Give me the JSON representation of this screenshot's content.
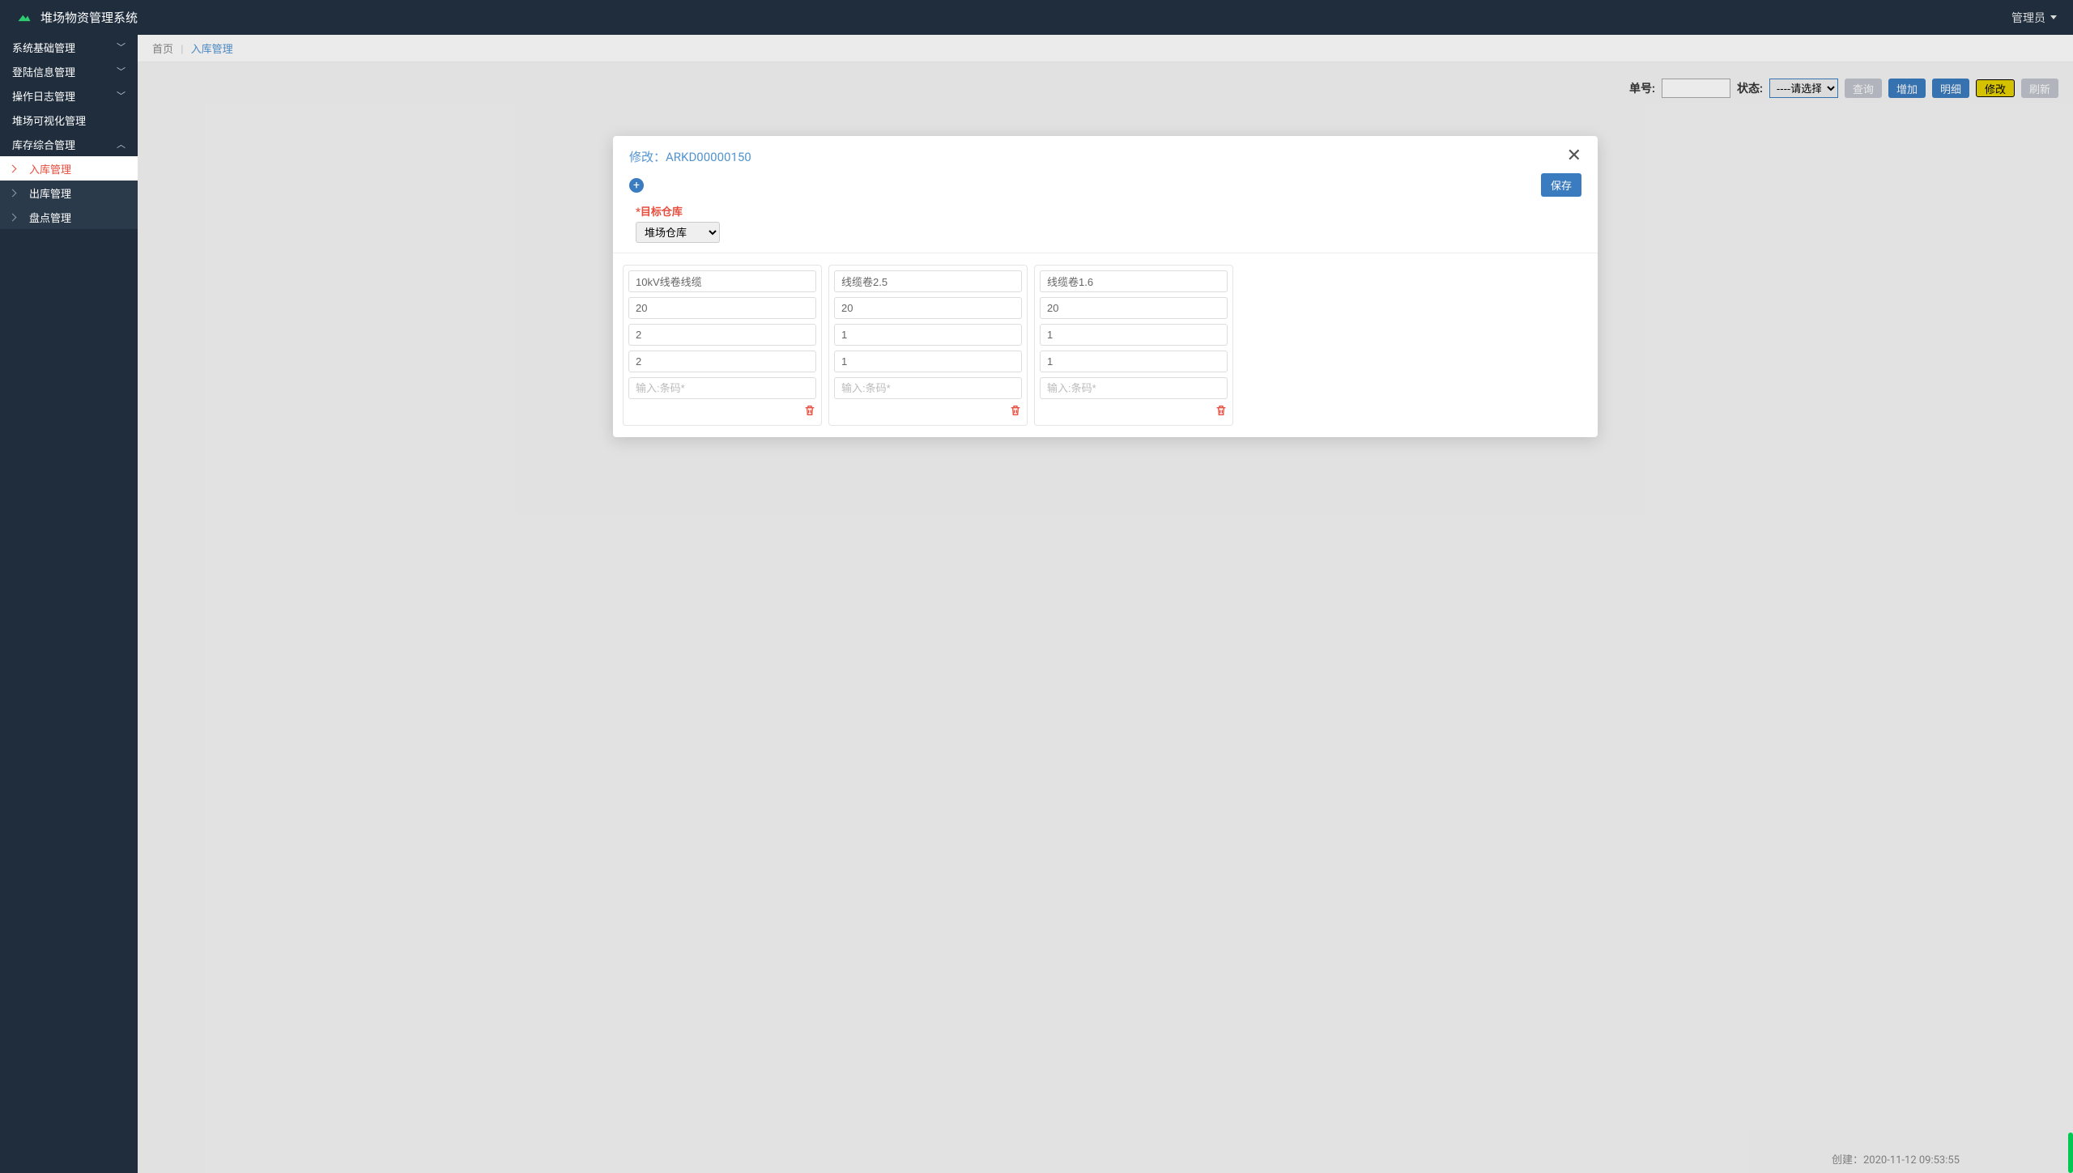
{
  "app": {
    "title": "堆场物资管理系统",
    "user": "管理员"
  },
  "sidebar": {
    "items": [
      {
        "label": "系统基础管理",
        "expandable": true
      },
      {
        "label": "登陆信息管理",
        "expandable": true
      },
      {
        "label": "操作日志管理",
        "expandable": true
      },
      {
        "label": "堆场可视化管理",
        "expandable": false
      },
      {
        "label": "库存综合管理",
        "expandable": true,
        "expanded": true
      }
    ],
    "sub": [
      {
        "label": "入库管理",
        "active": true
      },
      {
        "label": "出库管理",
        "active": false
      },
      {
        "label": "盘点管理",
        "active": false
      }
    ]
  },
  "breadcrumb": {
    "home": "首页",
    "current": "入库管理"
  },
  "filters": {
    "order_label": "单号:",
    "order_value": "",
    "status_label": "状态:",
    "status_placeholder": "----请选择----",
    "btn_query": "查询",
    "btn_add": "增加",
    "btn_detail": "明细",
    "btn_edit": "修改",
    "btn_refresh": "刷新"
  },
  "modal": {
    "title_prefix": "修改：",
    "title_id": "ARKD00000150",
    "save": "保存",
    "target_label": "*目标仓库",
    "target_value": "堆场仓库",
    "barcode_placeholder": "输入:条码*",
    "cards": [
      {
        "name": "10kV线卷线缆",
        "f2": "20",
        "f3": "2",
        "f4": "2"
      },
      {
        "name": "线缆卷2.5",
        "f2": "20",
        "f3": "1",
        "f4": "1"
      },
      {
        "name": "线缆卷1.6",
        "f2": "20",
        "f3": "1",
        "f4": "1"
      }
    ]
  },
  "bg": {
    "created_prefix": "创建：",
    "created_ts": "2020-11-12 09:53:55"
  }
}
